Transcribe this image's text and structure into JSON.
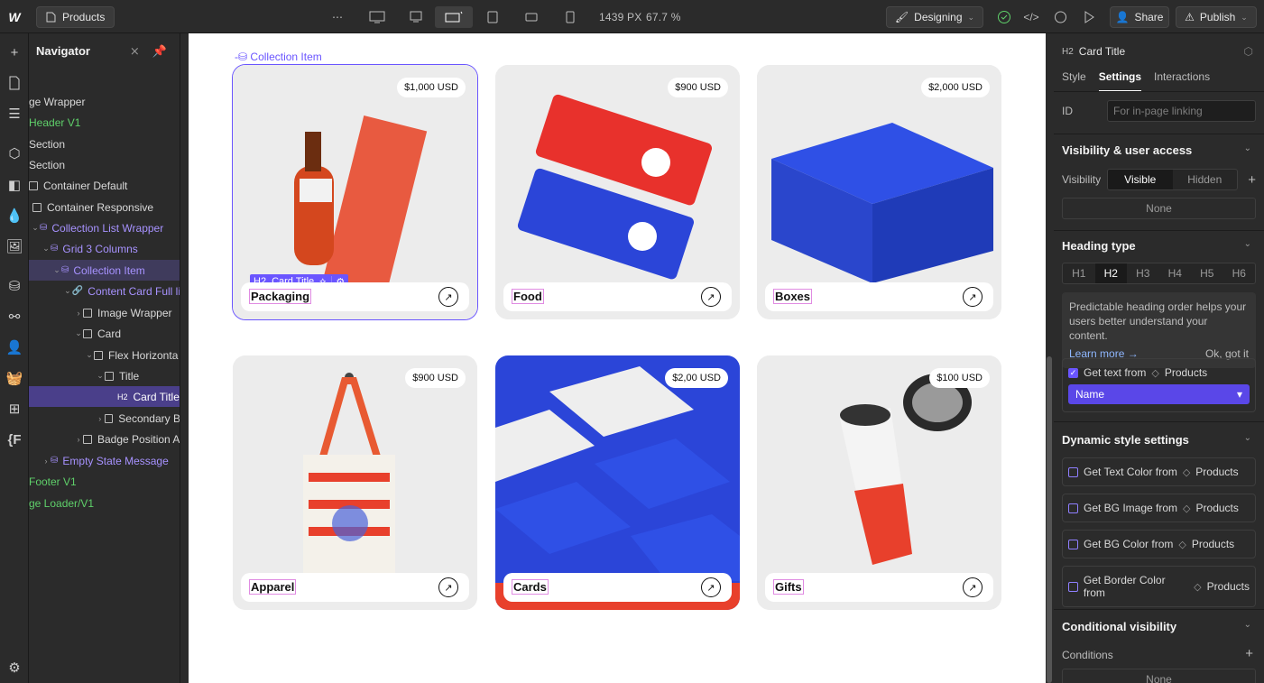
{
  "topbar": {
    "page_name": "Products",
    "breakpoint_width": "1439 PX",
    "zoom": "67.7 %",
    "mode": "Designing",
    "share_label": "Share",
    "publish_label": "Publish"
  },
  "navigator": {
    "title": "Navigator",
    "items": [
      {
        "label": "ge Wrapper"
      },
      {
        "label": "Header V1"
      },
      {
        "label": "Section"
      },
      {
        "label": "Section"
      },
      {
        "label": "Container Default"
      },
      {
        "label": "Container Responsive"
      },
      {
        "label": "Collection List Wrapper"
      },
      {
        "label": "Grid 3 Columns"
      },
      {
        "label": "Collection Item"
      },
      {
        "label": "Content Card Full li"
      },
      {
        "label": "Image Wrapper"
      },
      {
        "label": "Card"
      },
      {
        "label": "Flex Horizonta"
      },
      {
        "label": "Title"
      },
      {
        "label": "Card Title",
        "tag": "H2"
      },
      {
        "label": "Secondary B"
      },
      {
        "label": "Badge Position A"
      },
      {
        "label": "Empty State Message"
      },
      {
        "label": "Footer V1"
      },
      {
        "label": "ge Loader/V1"
      }
    ]
  },
  "canvas": {
    "collection_item_label": "Collection Item",
    "selection_badge": {
      "tag": "H2",
      "label": "Card Title"
    },
    "cards": [
      {
        "name": "Packaging",
        "price": "$1,000 USD"
      },
      {
        "name": "Food",
        "price": "$900 USD"
      },
      {
        "name": "Boxes",
        "price": "$2,000 USD"
      },
      {
        "name": "Apparel",
        "price": "$900 USD"
      },
      {
        "name": "Cards",
        "price": "$2,00 USD"
      },
      {
        "name": "Gifts",
        "price": "$100 USD"
      }
    ]
  },
  "panel": {
    "element_tag": "H2",
    "element_name": "Card Title",
    "tabs": [
      "Style",
      "Settings",
      "Interactions"
    ],
    "id_label": "ID",
    "id_placeholder": "For in-page linking",
    "visibility_section": "Visibility & user access",
    "visibility_label": "Visibility",
    "visible": "Visible",
    "hidden": "Hidden",
    "none": "None",
    "heading_type_section": "Heading type",
    "heading_options": [
      "H1",
      "H2",
      "H3",
      "H4",
      "H5",
      "H6"
    ],
    "hint_text": "Predictable heading order helps your users better understand your content.",
    "learn_more": "Learn more →",
    "ok_got_it": "Ok, got it",
    "get_text_from": "Get text from",
    "products": "Products",
    "field_name": "Name",
    "dynamic_section": "Dynamic style settings",
    "dynamic_items": [
      "Get Text Color from",
      "Get BG Image from",
      "Get BG Color from",
      "Get Border Color from"
    ],
    "conditional_section": "Conditional visibility",
    "conditions_label": "Conditions",
    "none_bottom": "None"
  }
}
